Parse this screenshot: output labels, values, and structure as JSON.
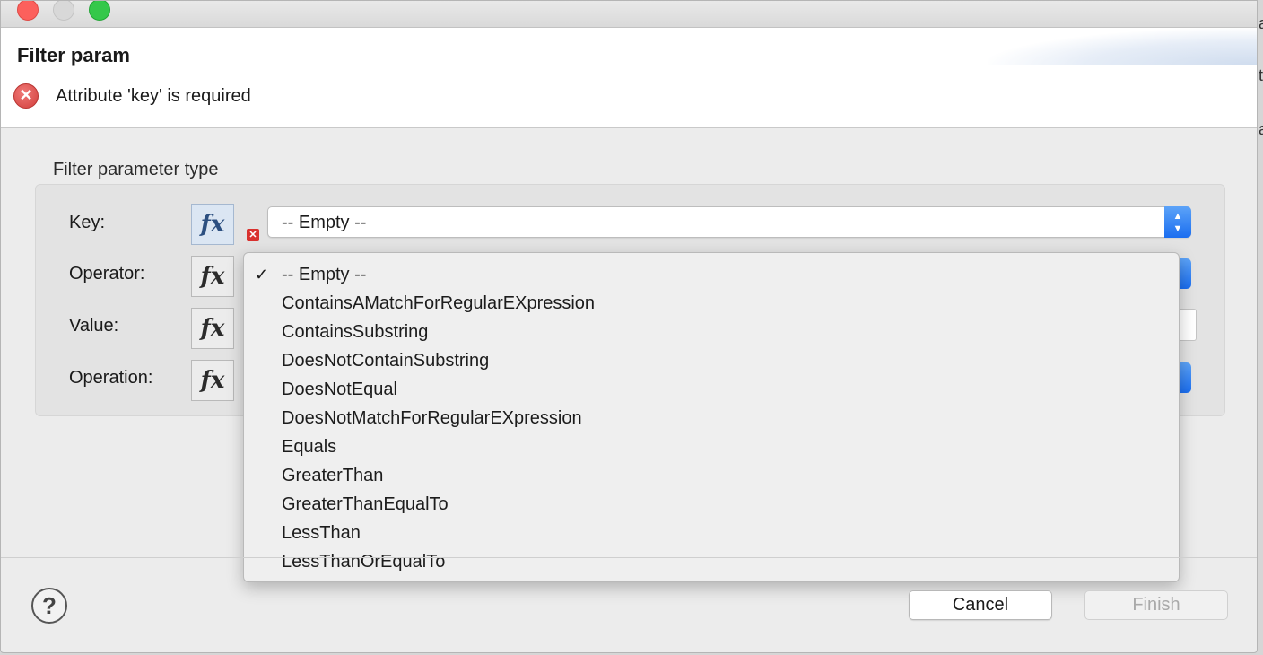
{
  "dialog": {
    "title": "Filter param",
    "error_message": "Attribute 'key' is required"
  },
  "group": {
    "label": "Filter parameter type"
  },
  "fields": {
    "key_label": "Key:",
    "operator_label": "Operator:",
    "value_label": "Value:",
    "operation_label": "Operation:",
    "fx_symbol": "fx",
    "key_value": "-- Empty --"
  },
  "dropdown": {
    "check": "✓",
    "options": [
      "-- Empty --",
      "ContainsAMatchForRegularEXpression",
      "ContainsSubstring",
      "DoesNotContainSubstring",
      "DoesNotEqual",
      "DoesNotMatchForRegularEXpression",
      "Equals",
      "GreaterThan",
      "GreaterThanEqualTo",
      "LessThan",
      "LessThanOrEqualTo"
    ],
    "selected": "-- Empty --"
  },
  "footer": {
    "help_symbol": "?",
    "cancel_label": "Cancel",
    "finish_label": "Finish"
  },
  "background_window": {
    "text_fragments": [
      "a",
      "t",
      "a"
    ]
  },
  "icons": {
    "error": "error-circle-x-icon",
    "field_error": "small-error-x-icon",
    "help": "help-question-icon",
    "stepper": "up-down-chevron-icon",
    "checkmark": "checkmark-icon"
  },
  "colors": {
    "error_red": "#d23e3b",
    "accent_blue": "#1b6ef0",
    "window_bg": "#ececec"
  }
}
